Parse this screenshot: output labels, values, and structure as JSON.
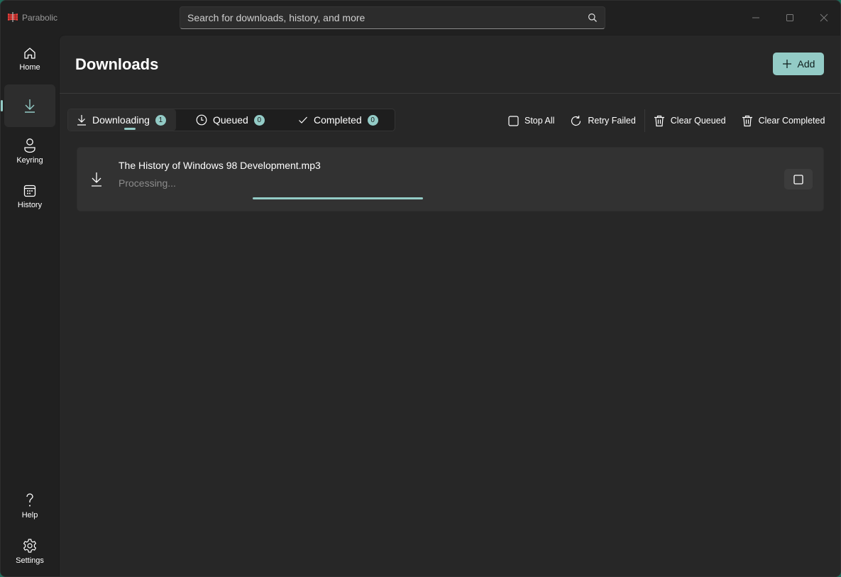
{
  "app": {
    "title": "Parabolic",
    "accent": "#93cbc6",
    "logo_color": "#e8413c"
  },
  "search": {
    "placeholder": "Search for downloads, history, and more",
    "value": ""
  },
  "window_controls": {
    "minimize": "minimize-icon",
    "maximize": "maximize-icon",
    "close": "close-icon"
  },
  "sidebar": {
    "items": [
      {
        "label": "Home",
        "icon": "home-icon",
        "active": false
      },
      {
        "label": "",
        "icon": "download-icon",
        "active": true
      },
      {
        "label": "Keyring",
        "icon": "person-icon",
        "active": false
      },
      {
        "label": "History",
        "icon": "calendar-icon",
        "active": false
      }
    ],
    "footer": [
      {
        "label": "Help",
        "icon": "question-icon"
      },
      {
        "label": "Settings",
        "icon": "gear-icon"
      }
    ]
  },
  "page": {
    "title": "Downloads",
    "add_label": "Add"
  },
  "tabs": [
    {
      "label": "Downloading",
      "count": "1",
      "icon": "download-icon",
      "active": true
    },
    {
      "label": "Queued",
      "count": "0",
      "icon": "clock-icon",
      "active": false
    },
    {
      "label": "Completed",
      "count": "0",
      "icon": "checkmark-icon",
      "active": false
    }
  ],
  "actions": [
    {
      "label": "Stop All",
      "icon": "stop-icon"
    },
    {
      "label": "Retry Failed",
      "icon": "retry-icon"
    },
    {
      "label": "Clear Queued",
      "icon": "trash-icon"
    },
    {
      "label": "Clear Completed",
      "icon": "trash-icon"
    }
  ],
  "downloads": [
    {
      "filename": "The History of Windows 98 Development.mp3",
      "status": "Processing...",
      "progress": "indeterminate"
    }
  ]
}
